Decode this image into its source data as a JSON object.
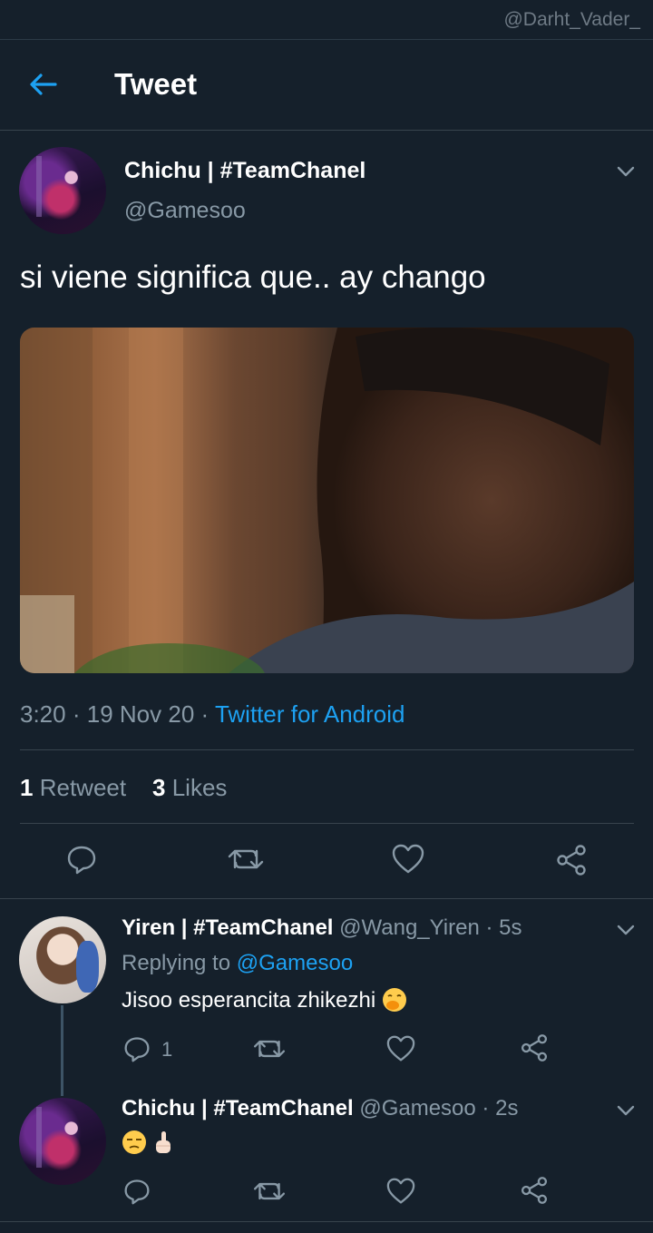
{
  "watermark": "@Darht_Vader_",
  "header": {
    "title": "Tweet"
  },
  "tweet": {
    "author": "Chichu | #TeamChanel",
    "handle": "@Gamesoo",
    "text": "si viene significa que.. ay chango",
    "time": "3:20",
    "date": "19 Nov 20",
    "source": "Twitter for Android",
    "retweets": "1",
    "retweets_label": "Retweet",
    "likes": "3",
    "likes_label": "Likes"
  },
  "replies": [
    {
      "author": "Yiren | #TeamChanel",
      "handle": "@Wang_Yiren",
      "time": "5s",
      "replying_prefix": "Replying to",
      "replying_to": "@Gamesoo",
      "text": "Jisoo esperancita zhikezhi",
      "reply_count": "1"
    },
    {
      "author": "Chichu | #TeamChanel",
      "handle": "@Gamesoo",
      "time": "2s"
    }
  ],
  "separators": {
    "dot": "·"
  },
  "colors": {
    "background": "#15202b",
    "accent": "#1da1f2",
    "muted": "#8899a6",
    "divider": "#38444d"
  }
}
